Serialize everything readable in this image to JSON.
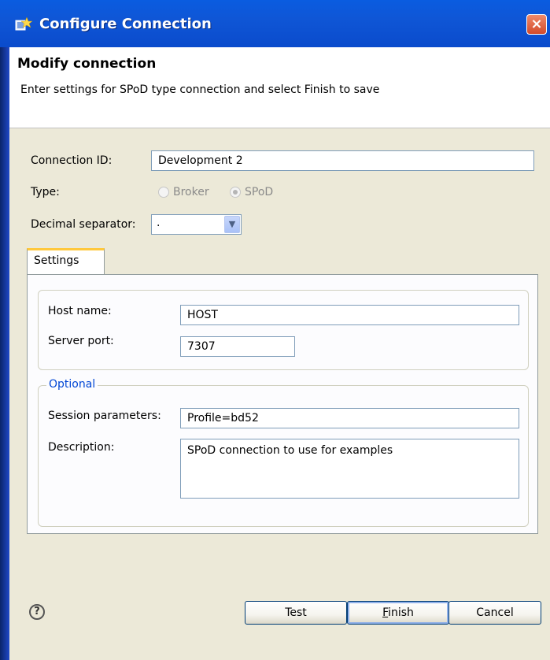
{
  "window": {
    "title": "Configure Connection",
    "close_label": "×"
  },
  "header": {
    "title": "Modify connection",
    "description": "Enter settings for SPoD type connection and select Finish to save"
  },
  "form": {
    "connection_id_label": "Connection ID:",
    "connection_id_value": "Development 2",
    "type_label": "Type:",
    "type_options": [
      "Broker",
      "SPoD"
    ],
    "type_selected": "SPoD",
    "decimal_label": "Decimal separator:",
    "decimal_value": "."
  },
  "tabs": {
    "settings_label": "Settings"
  },
  "settings": {
    "host_label": "Host name:",
    "host_value": "HOST",
    "port_label": "Server port:",
    "port_value": "7307"
  },
  "optional": {
    "legend": "Optional",
    "session_label": "Session parameters:",
    "session_value": "Profile=bd52",
    "description_label": "Description:",
    "description_value": "SPoD connection to use for examples"
  },
  "buttons": {
    "test": "Test",
    "finish_mnemonic": "F",
    "finish_rest": "inish",
    "cancel": "Cancel",
    "help_glyph": "?"
  },
  "colors": {
    "titlebar": "#0a5ce0",
    "legend": "#0046d5",
    "tab_highlight": "#ffc83c"
  }
}
